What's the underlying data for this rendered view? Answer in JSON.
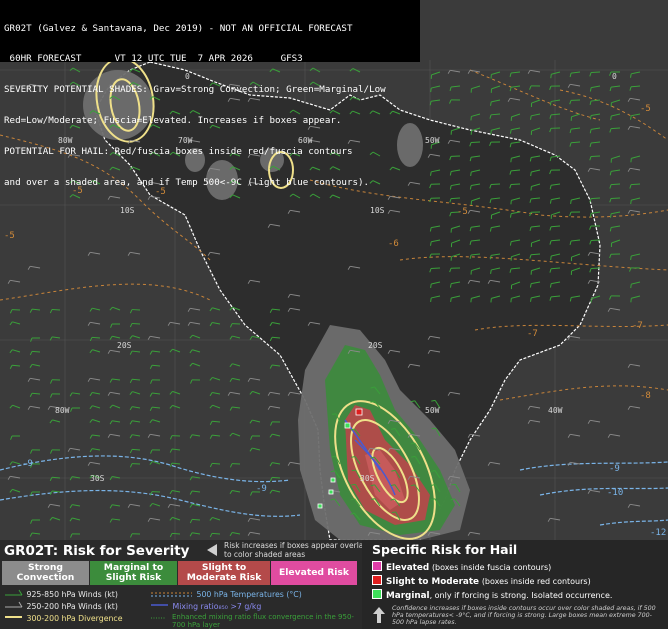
{
  "header": {
    "line1": "GR02T (Galvez & Santavana, Dec 2019) - NOT AN OFFICIAL FORECAST",
    "line2": " 60HR FORECAST      VT 12 UTC TUE  7 APR 2026     GFS3",
    "line3": "SEVERITY POTENTIAL SHADES: Grav=Strong Convection; Green=Marginal/Low",
    "line4": "Red=Low/Moderate; Fuscia=Elevated. Increases if boxes appear.",
    "line5": "POTENTIAL FOR HAIL: Red/fuscia boxes inside red/fuscia contours",
    "line6": "and over a shaded area, and if Temp 500<-9C (light blue contours)."
  },
  "map_labels": {
    "lon_80w": "80W",
    "lon_70w": "70W",
    "lon_60w": "60W",
    "lon_50w": "50W",
    "lon_40w": "40W",
    "lat_0": "0",
    "lat_10s": "10S",
    "lat_20s": "20S",
    "lat_30s": "30S",
    "lon_80w_b": "80W",
    "lon_50w_b": "50W",
    "lon_40w_b": "40W",
    "lat_10s_b": "10S",
    "lat_20s_b": "20S",
    "lat_30s_b": "30S",
    "lat_0_b": "0"
  },
  "contour_values": {
    "c1": "-5",
    "c2": "-5",
    "c3": "-5",
    "c4": "-6",
    "c5": "-5",
    "c6": "-5",
    "c7": "-7",
    "c8": "-7",
    "c9": "-8",
    "c10": "-9",
    "c11": "-9",
    "c12": "-10",
    "c13": "-12",
    "c14": "-9",
    "c15": "-5"
  },
  "legend": {
    "title": "GR02T: Risk for Severity",
    "note": "Risk increases if boxes appear overlaid to color shaded areas",
    "severity": [
      {
        "label": "Strong Convection",
        "color": "#8c8c8c",
        "text_color": "#ffffff"
      },
      {
        "label": "Marginal to Slight Risk",
        "color": "#3c8c3c",
        "text_color": "#ffffff"
      },
      {
        "label": "Slight to Moderate Risk",
        "color": "#b44a4a",
        "text_color": "#ffffff"
      },
      {
        "label": "Elevated Risk",
        "color": "#e04ca0",
        "text_color": "#ffffff"
      }
    ],
    "items": {
      "winds_925": "925-850 hPa Winds (kt)",
      "winds_250": "250-200 hPa Winds (kt)",
      "divergence": "300-200 hPa Divergence",
      "temps_500": "500 hPa Temperatures (°C)",
      "mixing": "Mixing ratio₈₅₀ >7 g/kg",
      "flux": "Enhanced mixing ratio flux convergence in the 950-700 hPa layer"
    }
  },
  "hail": {
    "title": "Specific Risk for Hail",
    "elevated_label": "Elevated",
    "elevated_text": "(boxes inside fuscia contours)",
    "moderate_label": "Slight to Moderate",
    "moderate_text": "(boxes inside red contours)",
    "marginal_label": "Marginal",
    "marginal_text": ", only if forcing is strong. Isolated occurrence.",
    "footnote": "Confidence increases if boxes inside contours occur over color shaded areas, if 500 hPa temperatures< -9°C, and if forcing is strong. Large boxes mean extreme 700-500 hPa lapse rates.",
    "colors": {
      "elevated": "#e03ca8",
      "moderate": "#e01e1e",
      "marginal": "#3ee05a"
    }
  }
}
